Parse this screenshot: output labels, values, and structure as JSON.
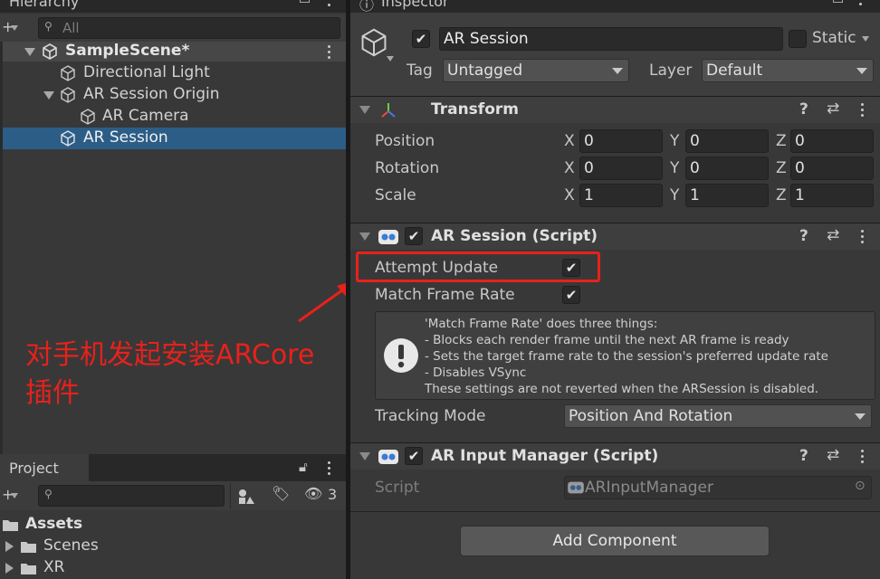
{
  "hierarchy": {
    "tab_title": "Hierarchy",
    "search_placeholder": "All",
    "items": [
      {
        "label": "SampleScene*"
      },
      {
        "label": "Directional Light"
      },
      {
        "label": "AR Session Origin"
      },
      {
        "label": "AR Camera"
      },
      {
        "label": "AR Session"
      }
    ]
  },
  "project": {
    "tab_title": "Project",
    "hidden_count": "3",
    "folders": [
      {
        "label": "Assets"
      },
      {
        "label": "Scenes"
      },
      {
        "label": "XR"
      }
    ]
  },
  "annotation": {
    "line1": "对手机发起安装ARCore",
    "line2": "插件"
  },
  "inspector": {
    "tab_title": "Inspector",
    "object_name": "AR Session",
    "static_label": "Static",
    "tag_label": "Tag",
    "tag_value": "Untagged",
    "layer_label": "Layer",
    "layer_value": "Default",
    "transform": {
      "title": "Transform",
      "rows": [
        {
          "label": "Position",
          "x": "0",
          "y": "0",
          "z": "0"
        },
        {
          "label": "Rotation",
          "x": "0",
          "y": "0",
          "z": "0"
        },
        {
          "label": "Scale",
          "x": "1",
          "y": "1",
          "z": "1"
        }
      ],
      "axis_x": "X",
      "axis_y": "Y",
      "axis_z": "Z"
    },
    "ar_session": {
      "title": "AR Session (Script)",
      "attempt_update": "Attempt Update",
      "match_frame_rate": "Match Frame Rate",
      "help_lines": [
        "'Match Frame Rate' does three things:",
        "- Blocks each render frame until the next AR frame is ready",
        "- Sets the target frame rate to the session's preferred update rate",
        "- Disables VSync",
        "These settings are not reverted when the ARSession is disabled."
      ],
      "tracking_mode_label": "Tracking Mode",
      "tracking_mode_value": "Position And Rotation"
    },
    "ar_input_manager": {
      "title": "AR Input Manager (Script)",
      "script_label": "Script",
      "script_value": "ARInputManager"
    },
    "add_component": "Add Component"
  },
  "colors": {
    "selection": "#2c5d87",
    "annotation_red": "#e8211b",
    "panel": "#383838"
  }
}
